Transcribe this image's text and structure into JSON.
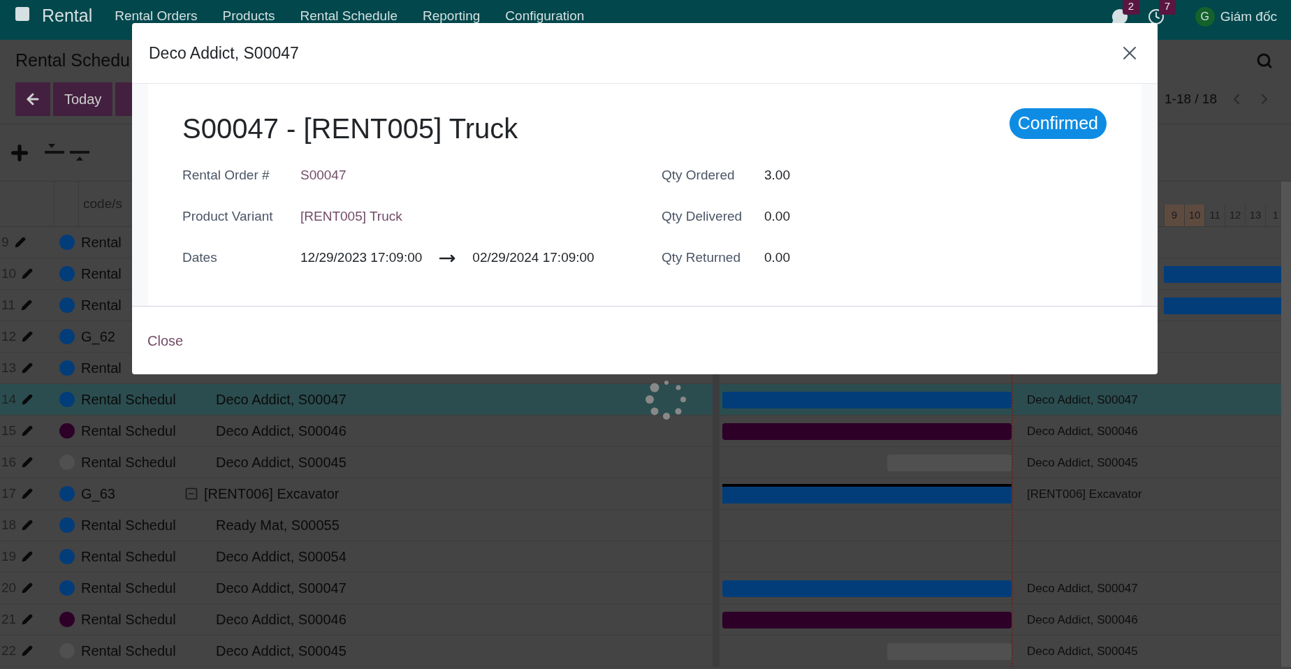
{
  "app": {
    "name": "Rental",
    "menu": [
      "Rental Orders",
      "Products",
      "Rental Schedule",
      "Reporting",
      "Configuration"
    ],
    "messages_badge": "2",
    "activities_badge": "7",
    "avatar": "G",
    "user": "Giám đốc"
  },
  "breadcrumb": "Rental Schedu",
  "buttons": {
    "today": "Today"
  },
  "pager": "1-18 / 18",
  "table": {
    "column_3": "code/s",
    "days": [
      {
        "label": "9",
        "weekend": true
      },
      {
        "label": "10",
        "weekend": true
      },
      {
        "label": "11",
        "weekend": false
      },
      {
        "label": "12",
        "weekend": false
      },
      {
        "label": "13",
        "weekend": false
      },
      {
        "label": "1",
        "weekend": false
      }
    ],
    "rows": [
      {
        "number": "9",
        "color": "#023d7a",
        "code": "Rental",
        "kind": "empty",
        "label": "",
        "highlighted": false
      },
      {
        "number": "10",
        "color": "#023d7a",
        "code": "Rental",
        "kind": "right",
        "label": "",
        "highlighted": false
      },
      {
        "number": "11",
        "color": "#023d7a",
        "code": "Rental",
        "kind": "right",
        "label": "",
        "highlighted": false
      },
      {
        "number": "12",
        "color": "#023d7a",
        "code": "G_62",
        "kind": "empty",
        "label": "",
        "highlighted": false
      },
      {
        "number": "13",
        "color": "#023d7a",
        "code": "Rental",
        "kind": "empty",
        "label": "",
        "highlighted": false
      },
      {
        "number": "14",
        "color": "#023d7a",
        "code": "Rental Schedul",
        "name": "Deco Addict, S00047",
        "kind": "full",
        "label": "Deco Addict, S00047",
        "highlighted": true,
        "expandable": false
      },
      {
        "number": "15",
        "color": "#2d0028",
        "code": "Rental Schedul",
        "name": "Deco Addict, S00046",
        "kind": "full",
        "label": "Deco Addict, S00046",
        "highlighted": false,
        "expandable": false
      },
      {
        "number": "16",
        "color": "#505050",
        "code": "Rental Schedul",
        "name": "Deco Addict, S00045",
        "kind": "tail",
        "label": "Deco Addict, S00045",
        "highlighted": false,
        "expandable": false
      },
      {
        "number": "17",
        "color": "#023d7a",
        "code": "G_63",
        "name": "[RENT006] Excavator",
        "kind": "group",
        "label": "[RENT006] Excavator",
        "highlighted": false,
        "expandable": true
      },
      {
        "number": "18",
        "color": "#023d7a",
        "code": "Rental Schedul",
        "name": "Ready Mat, S00055",
        "kind": "empty",
        "label": "",
        "highlighted": false,
        "expandable": false
      },
      {
        "number": "19",
        "color": "#023d7a",
        "code": "Rental Schedul",
        "name": "Deco Addict, S00054",
        "kind": "empty",
        "label": "",
        "highlighted": false,
        "expandable": false
      },
      {
        "number": "20",
        "color": "#023d7a",
        "code": "Rental Schedul",
        "name": "Deco Addict, S00047",
        "kind": "full",
        "label": "Deco Addict, S00047",
        "highlighted": false,
        "expandable": false
      },
      {
        "number": "21",
        "color": "#2d0028",
        "code": "Rental Schedul",
        "name": "Deco Addict, S00046",
        "kind": "full",
        "label": "Deco Addict, S00046",
        "highlighted": false,
        "expandable": false
      },
      {
        "number": "22",
        "color": "#505050",
        "code": "Rental Schedul",
        "name": "Deco Addict, S00045",
        "kind": "tail",
        "label": "Deco Addict, S00045",
        "highlighted": false,
        "expandable": false
      }
    ]
  },
  "dialog": {
    "title": "Deco Addict, S00047",
    "heading": "S00047 - [RENT005] Truck",
    "status": "Confirmed",
    "left_fields": [
      {
        "label": "Rental Order #",
        "value": "S00047",
        "kind": "link"
      },
      {
        "label": "Product Variant",
        "value": "[RENT005] Truck",
        "kind": "link"
      },
      {
        "label": "Dates",
        "value": "12/29/2023 17:09:00",
        "end": "02/29/2024 17:09:00",
        "kind": "range"
      }
    ],
    "right_fields": [
      {
        "label": "Qty Ordered",
        "value": "3.00"
      },
      {
        "label": "Qty Delivered",
        "value": "0.00"
      },
      {
        "label": "Qty Returned",
        "value": "0.00"
      }
    ],
    "close": "Close"
  }
}
